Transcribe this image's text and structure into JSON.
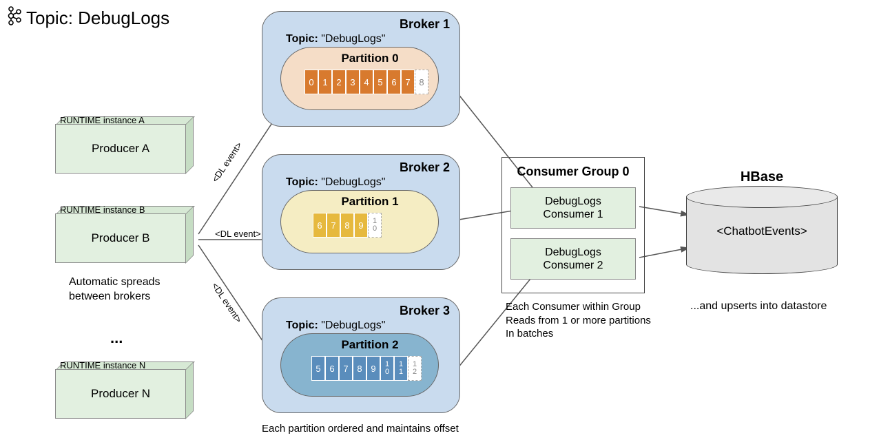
{
  "header": {
    "topic_label": "Topic: DebugLogs"
  },
  "producers": {
    "a": {
      "runtime": "RUNTIME instance A",
      "name": "Producer A"
    },
    "b": {
      "runtime": "RUNTIME instance B",
      "name": "Producer B"
    },
    "n": {
      "runtime": "RUNTIME instance N",
      "name": "Producer N"
    },
    "ellipsis": "...",
    "spread_note_l1": "Automatic spreads",
    "spread_note_l2": "between brokers"
  },
  "arrows": {
    "event1": "<DL event>",
    "event2": "<DL event>",
    "event3": "<DL event>"
  },
  "brokers": {
    "b1": {
      "title": "Broker 1",
      "topic_prefix": "Topic: ",
      "topic_name": "\"DebugLogs\"",
      "partition_title": "Partition 0",
      "offsets": [
        "0",
        "1",
        "2",
        "3",
        "4",
        "5",
        "6",
        "7"
      ],
      "pending": [
        "8"
      ]
    },
    "b2": {
      "title": "Broker 2",
      "topic_prefix": "Topic: ",
      "topic_name": "\"DebugLogs\"",
      "partition_title": "Partition 1",
      "offsets": [
        "6",
        "7",
        "8",
        "9"
      ],
      "pending_stack": [
        [
          "1",
          "0"
        ]
      ]
    },
    "b3": {
      "title": "Broker 3",
      "topic_prefix": "Topic: ",
      "topic_name": "\"DebugLogs\"",
      "partition_title": "Partition 2",
      "offsets": [
        "5",
        "6",
        "7",
        "8",
        "9"
      ],
      "offsets_stack": [
        [
          "1",
          "0"
        ],
        [
          "1",
          "1"
        ]
      ],
      "pending_stack": [
        [
          "1",
          "2"
        ]
      ]
    },
    "partition_note": "Each partition ordered and maintains offset"
  },
  "consumer_group": {
    "title": "Consumer Group 0",
    "c1_l1": "DebugLogs",
    "c1_l2": "Consumer 1",
    "c2_l1": "DebugLogs",
    "c2_l2": "Consumer 2",
    "note_l1": "Each Consumer within Group",
    "note_l2": "Reads from 1 or more partitions",
    "note_l3": "In batches"
  },
  "hbase": {
    "title": "HBase",
    "table": "<ChatbotEvents>",
    "note": "...and upserts into datastore"
  }
}
